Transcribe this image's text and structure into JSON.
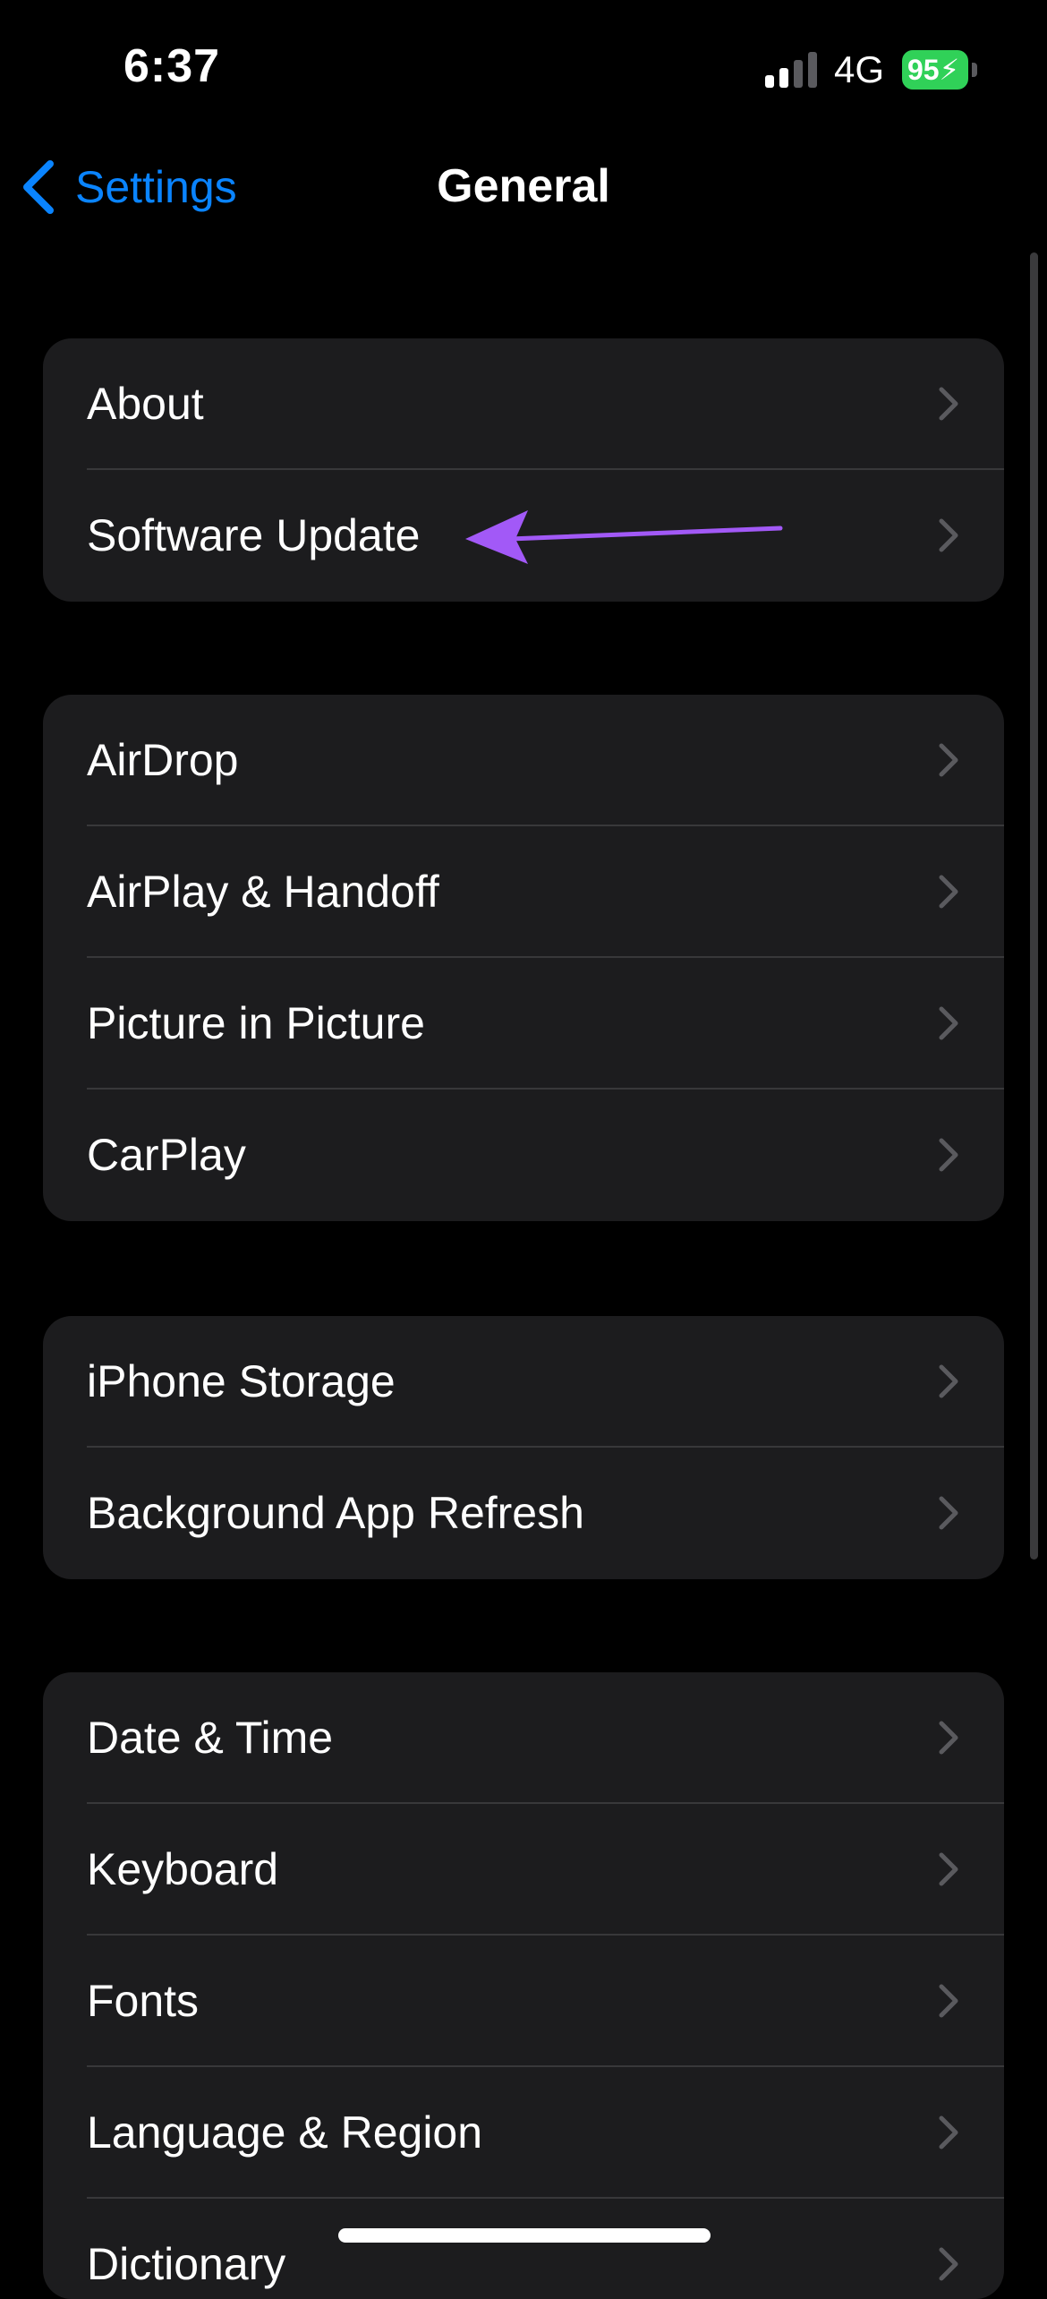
{
  "status_bar": {
    "time": "6:37",
    "network": "4G",
    "battery_level": "95"
  },
  "nav": {
    "back_label": "Settings",
    "title": "General"
  },
  "colors": {
    "accent": "#0a84ff",
    "annotation": "#a259f7",
    "battery": "#30d158"
  },
  "groups": [
    {
      "items": [
        "About",
        "Software Update"
      ]
    },
    {
      "items": [
        "AirDrop",
        "AirPlay & Handoff",
        "Picture in Picture",
        "CarPlay"
      ]
    },
    {
      "items": [
        "iPhone Storage",
        "Background App Refresh"
      ]
    },
    {
      "items": [
        "Date & Time",
        "Keyboard",
        "Fonts",
        "Language & Region",
        "Dictionary"
      ]
    }
  ]
}
